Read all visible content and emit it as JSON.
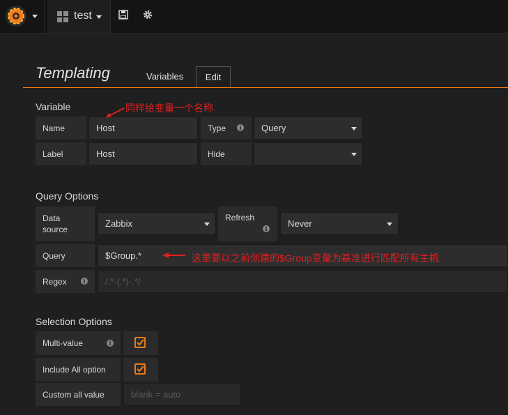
{
  "topbar": {
    "dashboard_title": "test",
    "save_icon": "save-icon",
    "settings_icon": "gear-icon"
  },
  "page": {
    "title": "Templating",
    "tabs": [
      {
        "label": "Variables",
        "active": false
      },
      {
        "label": "Edit",
        "active": true
      }
    ],
    "accent_color": "#eb7b18"
  },
  "variable": {
    "section_title": "Variable",
    "name_label": "Name",
    "name_value": "Host",
    "type_label": "Type",
    "type_value": "Query",
    "label_label": "Label",
    "label_value": "Host",
    "hide_label": "Hide",
    "hide_value": ""
  },
  "query_options": {
    "section_title": "Query Options",
    "datasource_label": "Data source",
    "datasource_value": "Zabbix",
    "refresh_label": "Refresh",
    "refresh_value": "Never",
    "query_label": "Query",
    "query_value": "$Group.*",
    "regex_label": "Regex",
    "regex_placeholder": "/.*-(.*)-.*/"
  },
  "selection_options": {
    "section_title": "Selection Options",
    "multi_value_label": "Multi-value",
    "multi_value_checked": true,
    "include_all_label": "Include All option",
    "include_all_checked": true,
    "custom_all_label": "Custom all value",
    "custom_all_placeholder": "blank = auto"
  },
  "annotations": {
    "name_note": "同样给变量一个名称",
    "query_note": "这里要以之前创建的$Group变量为基准进行匹配所有主机",
    "color": "#e02020"
  }
}
